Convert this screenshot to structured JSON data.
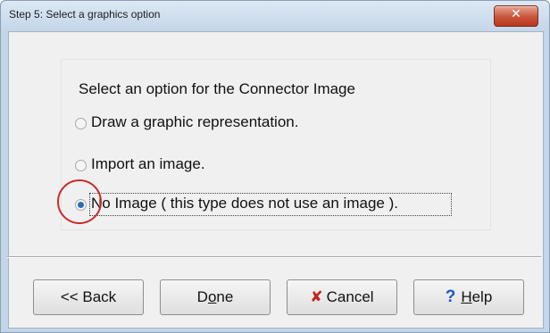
{
  "window": {
    "title": "Step 5: Select a graphics option",
    "close_glyph": "✕"
  },
  "group": {
    "title": "Select an option for the Connector Image",
    "options": [
      {
        "label": "Draw a graphic representation.",
        "checked": false
      },
      {
        "label": "Import an image.",
        "checked": false
      },
      {
        "label": "No Image ( this type does not use an image ).",
        "checked": true
      }
    ]
  },
  "buttons": {
    "back": "<< Back",
    "done_pre": "D",
    "done_ul": "o",
    "done_post": "ne",
    "cancel_icon": "✘",
    "cancel": "Cancel",
    "help_icon": "?",
    "help_ul": "H",
    "help_post": "elp"
  },
  "colors": {
    "highlight_circle": "#c92b2b",
    "radio_checked": "#2c6db5",
    "close_button": "#c8543a"
  }
}
